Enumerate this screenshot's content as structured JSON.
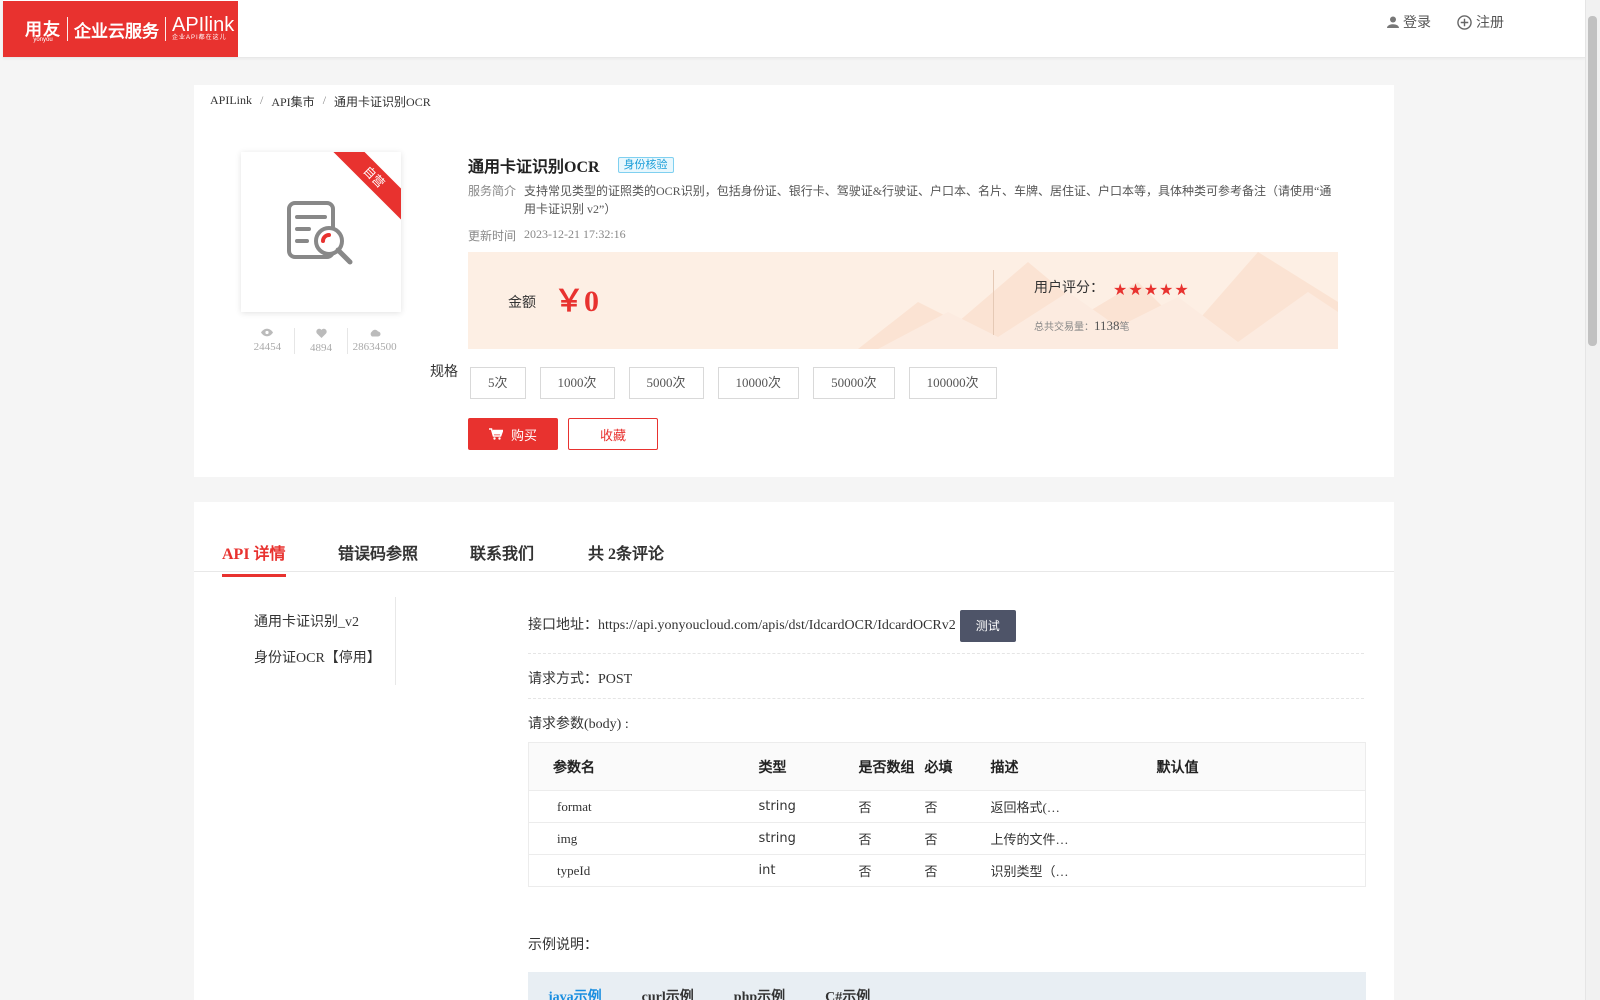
{
  "header": {
    "logo_brand": "用友",
    "logo_brand_sub": "yonyou",
    "logo_service": "企业云服务",
    "logo_product": "APIlink",
    "logo_tagline": "企业API都在这儿",
    "login": "登录",
    "register": "注册"
  },
  "breadcrumb": [
    "APILink",
    "API集市",
    "通用卡证识别OCR"
  ],
  "product": {
    "ribbon": "自营",
    "stats": {
      "views": "24454",
      "likes": "4894",
      "calls": "28634500"
    },
    "title": "通用卡证识别OCR",
    "tag": "身份核验",
    "intro_label": "服务简介",
    "intro_text": "支持常见类型的证照类的OCR识别，包括身份证、银行卡、驾驶证&行驶证、户口本、名片、车牌、居住证、户口本等，具体种类可参考备注（请使用“通用卡证识别 v2”）",
    "updated_label": "更新时间",
    "updated_value": "2023-12-21 17:32:16",
    "price_label": "金额",
    "price_value": "￥0",
    "rating_label": "用户评分：",
    "rating": 5,
    "tx_label": "总共交易量：",
    "tx_value": "1138",
    "tx_unit": "笔",
    "spec_label": "规格",
    "specs": [
      "5次",
      "1000次",
      "5000次",
      "10000次",
      "50000次",
      "100000次"
    ],
    "buy": "购买",
    "favorite": "收藏"
  },
  "tabs": [
    "API 详情",
    "错误码参照",
    "联系我们",
    "共 2条评论"
  ],
  "sidemenu": [
    "通用卡证识别_v2",
    "身份证OCR【停用】"
  ],
  "api": {
    "endpoint_label": "接口地址：",
    "endpoint": "https://api.yonyoucloud.com/apis/dst/IdcardOCR/IdcardOCRv2",
    "test_button": "测试",
    "method_label": "请求方式：",
    "method": "POST",
    "params_label": "请求参数(body) :",
    "columns": [
      "参数名",
      "类型",
      "是否数组",
      "必填",
      "描述",
      "默认值"
    ],
    "params": [
      {
        "name": "format",
        "type": "string",
        "array": "否",
        "required": "否",
        "desc": "返回格式(…",
        "default": ""
      },
      {
        "name": "img",
        "type": "string",
        "array": "否",
        "required": "否",
        "desc": "上传的文件…",
        "default": ""
      },
      {
        "name": "typeId",
        "type": "int",
        "array": "否",
        "required": "否",
        "desc": "识别类型（…",
        "default": ""
      }
    ],
    "example_label": "示例说明：",
    "example_tabs": [
      "java示例",
      "curl示例",
      "php示例",
      "C#示例"
    ]
  },
  "colors": {
    "accent": "#e8322f",
    "tag": "#1a9ed8",
    "price_bg": "#fdefe4"
  }
}
